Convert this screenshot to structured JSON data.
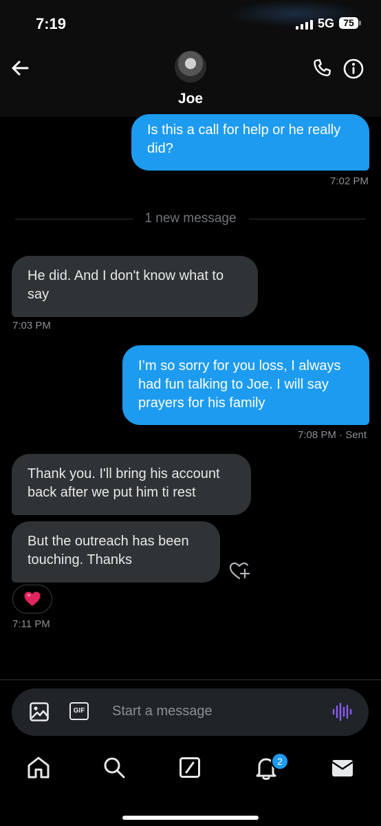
{
  "status_bar": {
    "time": "7:19",
    "network": "5G",
    "battery": "75"
  },
  "header": {
    "contact_name": "Joe"
  },
  "messages": [
    {
      "text": "Is this a call for help or he really did?",
      "time": "7:02 PM"
    },
    {
      "divider": "1 new message"
    },
    {
      "text": "He did. And I don't know what to say",
      "time": "7:03 PM"
    },
    {
      "text": "I’m so sorry for you loss, I always had fun talking to Joe. I will say prayers for his family",
      "time": "7:08 PM",
      "status": "· Sent"
    },
    {
      "text": "Thank you. I'll bring his account back after we put him ti rest"
    },
    {
      "text": "But the outreach has been touching. Thanks",
      "reaction": "❤️",
      "time": "7:11 PM"
    }
  ],
  "composer": {
    "placeholder": "Start a message",
    "gif_label": "GIF"
  },
  "bottom_nav": {
    "notification_count": "2"
  },
  "colors": {
    "accent": "#1d9bf0",
    "incoming_bubble": "#2f3336",
    "background": "#000000",
    "voice_icon": "#8b5cf6"
  }
}
